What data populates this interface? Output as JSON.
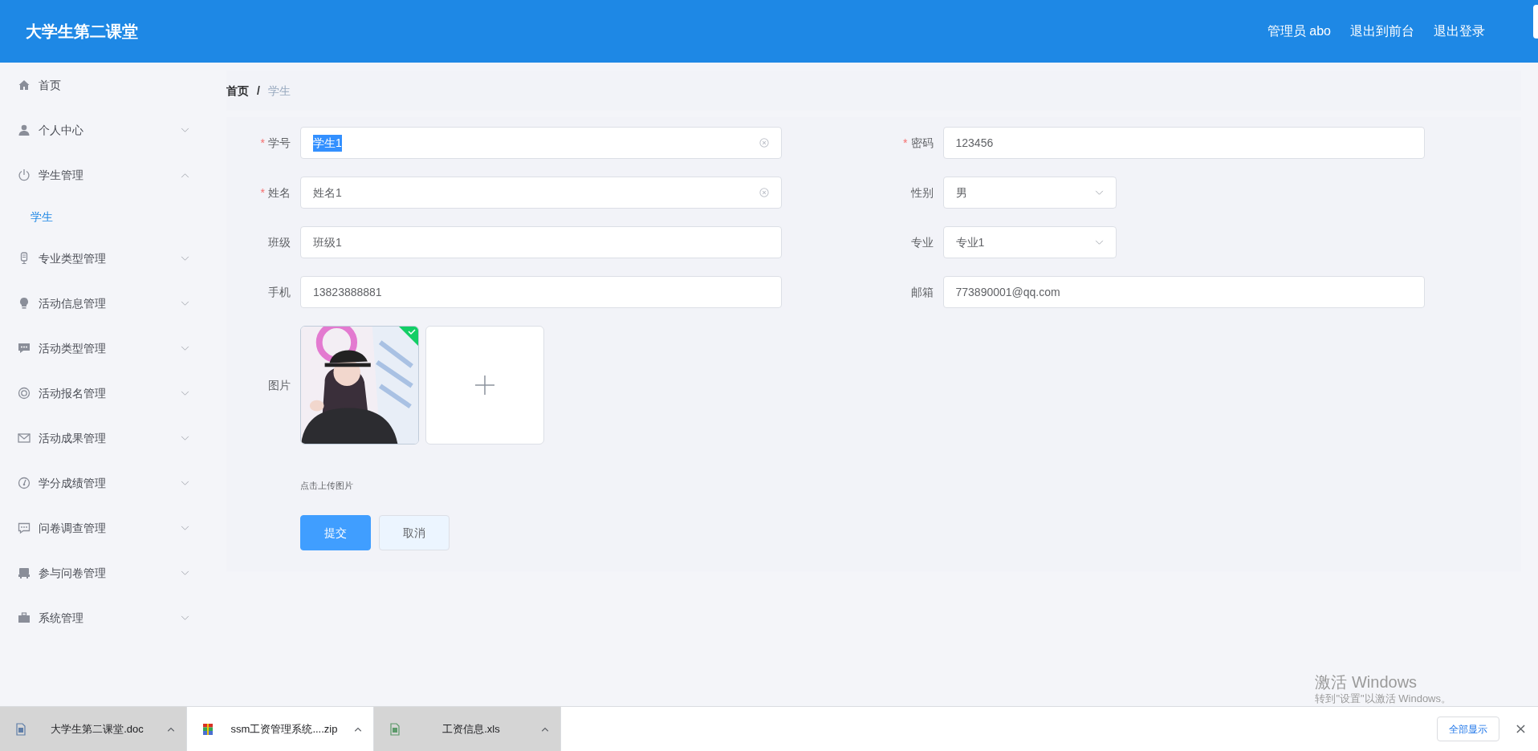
{
  "header": {
    "title": "大学生第二课堂",
    "links": [
      "管理员 abo",
      "退出到前台",
      "退出登录"
    ]
  },
  "sidebar": {
    "items": [
      {
        "label": "首页",
        "selected": false
      },
      {
        "label": "个人中心",
        "selected": false,
        "expanded": false
      },
      {
        "label": "学生管理",
        "selected": false,
        "expanded": true,
        "children": [
          {
            "label": "学生",
            "selected": true
          }
        ]
      },
      {
        "label": "专业类型管理",
        "selected": false,
        "expanded": false
      },
      {
        "label": "活动信息管理",
        "selected": false,
        "expanded": false
      },
      {
        "label": "活动类型管理",
        "selected": false,
        "expanded": false
      },
      {
        "label": "活动报名管理",
        "selected": false,
        "expanded": false
      },
      {
        "label": "活动成果管理",
        "selected": false,
        "expanded": false
      },
      {
        "label": "学分成绩管理",
        "selected": false,
        "expanded": false
      },
      {
        "label": "问卷调查管理",
        "selected": false,
        "expanded": false
      },
      {
        "label": "参与问卷管理",
        "selected": false,
        "expanded": false
      },
      {
        "label": "系统管理",
        "selected": false,
        "expanded": false
      }
    ]
  },
  "breadcrumb": {
    "separator": "/",
    "items": [
      "首页",
      "学生"
    ]
  },
  "form": {
    "required_mark": "*",
    "fields": [
      {
        "label": "学号",
        "kind": "text",
        "required": true,
        "value": "学生1",
        "clearable": true,
        "text_selected": true
      },
      {
        "label": "密码",
        "kind": "text",
        "required": true,
        "value": "123456",
        "clearable": false,
        "text_selected": false
      },
      {
        "label": "姓名",
        "kind": "text",
        "required": true,
        "value": "姓名1",
        "clearable": true,
        "text_selected": false
      },
      {
        "label": "性别",
        "kind": "select",
        "required": false,
        "value": "男"
      },
      {
        "label": "班级",
        "kind": "text",
        "required": false,
        "value": "班级1",
        "clearable": false,
        "text_selected": false
      },
      {
        "label": "专业",
        "kind": "select",
        "required": false,
        "value": "专业1"
      },
      {
        "label": "手机",
        "kind": "text",
        "required": false,
        "value": "13823888881",
        "clearable": false,
        "text_selected": false
      },
      {
        "label": "邮箱",
        "kind": "text",
        "required": false,
        "value": "773890001@qq.com",
        "clearable": false,
        "text_selected": false
      }
    ],
    "upload": {
      "label": "图片",
      "files": [
        {
          "kind": "picture",
          "success": true
        }
      ],
      "hint": "点击上传图片"
    },
    "buttons": [
      {
        "label": "提交",
        "kind": "primary"
      },
      {
        "label": "取消",
        "kind": "default"
      }
    ]
  },
  "os_notice": {
    "title": "激活 Windows",
    "text": "转到\"设置\"以激活 Windows。"
  },
  "downloads": {
    "items": [
      {
        "name": "大学生第二课堂.doc",
        "kind": "doc",
        "highlighted": true
      },
      {
        "name": "ssm工资管理系统....zip",
        "kind": "zip",
        "highlighted": false
      },
      {
        "name": "工资信息.xls",
        "kind": "xls",
        "highlighted": true
      }
    ],
    "show_all": "全部显示"
  }
}
